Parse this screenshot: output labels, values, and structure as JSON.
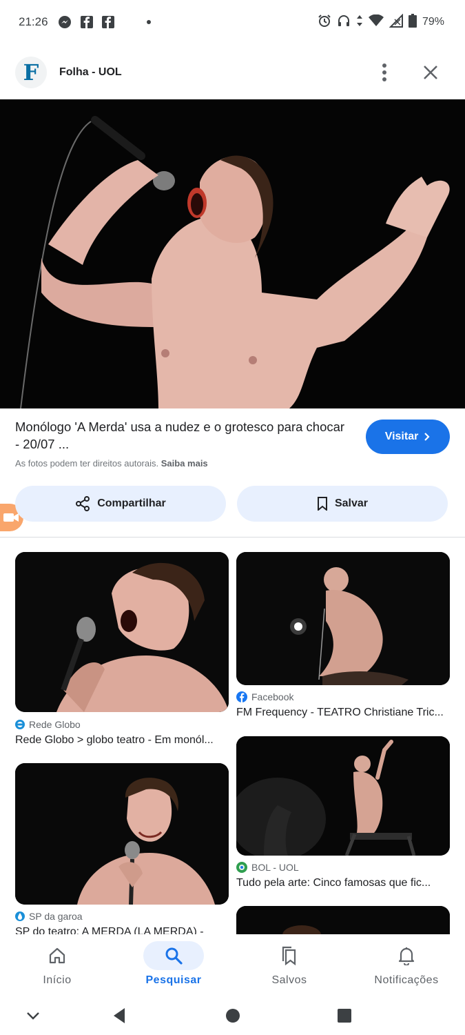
{
  "status_bar": {
    "time": "21:26",
    "left_icons": [
      "messenger-icon",
      "facebook-icon",
      "facebook-icon",
      "dot-icon"
    ],
    "right_icons": [
      "alarm-icon",
      "headphones-icon",
      "data-arrows-icon",
      "wifi-icon",
      "signal-icon",
      "battery-icon"
    ],
    "battery_percent": "79%"
  },
  "header": {
    "favicon_letter": "F",
    "site_name": "Folha - UOL",
    "more_icon": "more-vert-icon",
    "close_icon": "close-icon"
  },
  "result": {
    "title": "Monólogo 'A Merda' usa a nudez e o grotesco para chocar - 20/07 ...",
    "copyright_text": "As fotos podem ter direitos autorais.",
    "copyright_link": "Saiba mais",
    "visit_label": "Visitar",
    "share_label": "Compartilhar",
    "save_label": "Salvar"
  },
  "related": [
    {
      "source": "Rede Globo",
      "source_icon": "globo-icon",
      "caption": "Rede Globo > globo teatro - Em monól..."
    },
    {
      "source": "Facebook",
      "source_icon": "facebook-icon",
      "caption": "FM Frequency - TEATRO Christiane Tric..."
    },
    {
      "source": "BOL - UOL",
      "source_icon": "bol-icon",
      "caption": "Tudo pela arte: Cinco famosas que fic..."
    },
    {
      "source": "SP da garoa",
      "source_icon": "spgaroa-icon",
      "caption": "SP do teatro: A MERDA (LA MERDA) -"
    }
  ],
  "bottom_nav": [
    {
      "label": "Início",
      "icon": "home-icon",
      "active": false
    },
    {
      "label": "Pesquisar",
      "icon": "search-icon",
      "active": true
    },
    {
      "label": "Salvos",
      "icon": "bookmarks-icon",
      "active": false
    },
    {
      "label": "Notificações",
      "icon": "bell-icon",
      "active": false
    }
  ],
  "colors": {
    "accent": "#1a73e8",
    "button_tint": "#e8f0fe",
    "photo_background": "#050505"
  }
}
